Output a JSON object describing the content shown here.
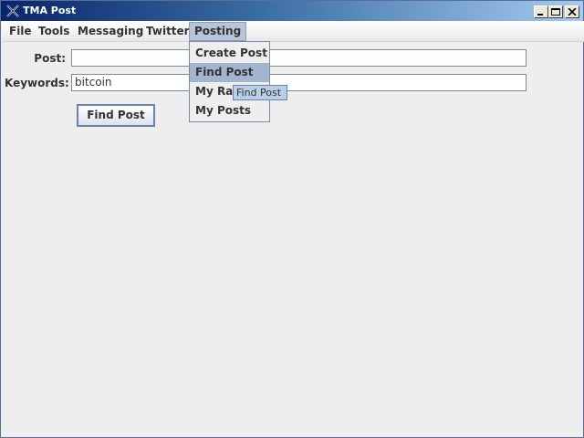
{
  "window": {
    "title": "TMA Post",
    "icons": {
      "app": "java-x-icon",
      "minimize": "minimize-icon",
      "maximize": "maximize-icon",
      "close": "close-icon"
    }
  },
  "menubar": {
    "items": [
      {
        "label": "File"
      },
      {
        "label": "Tools"
      },
      {
        "label": "Messaging"
      },
      {
        "label": "Twitter"
      },
      {
        "label": "Posting"
      }
    ],
    "active": "Posting"
  },
  "posting_menu": {
    "items": [
      {
        "label": "Create Post"
      },
      {
        "label": "Find Post"
      },
      {
        "label": "My Ratings"
      },
      {
        "label": "My Posts"
      }
    ],
    "highlighted": "Find Post"
  },
  "tooltip": {
    "text": "Find Post"
  },
  "form": {
    "post_label": "Post:",
    "post_value": "",
    "keywords_label": "Keywords:",
    "keywords_value": "bitcoin",
    "submit_label": "Find Post"
  },
  "colors": {
    "titlebar_start": "#0a246a",
    "titlebar_end": "#a6caf0",
    "menu_highlight": "#a3b4cf",
    "tooltip_bg": "#b8cfe5",
    "background": "#eeeeee"
  }
}
